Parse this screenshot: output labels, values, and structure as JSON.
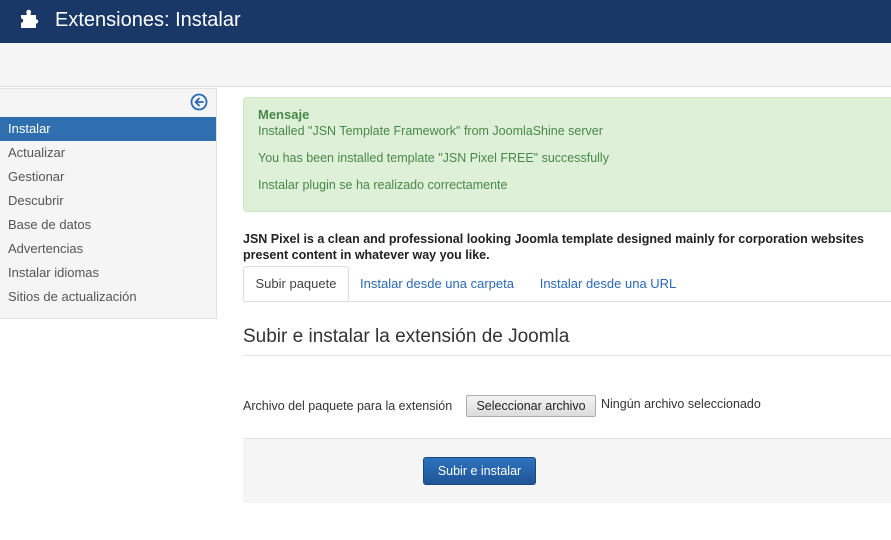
{
  "header": {
    "title": "Extensiones: Instalar",
    "icon": "puzzle-piece-icon"
  },
  "sidebar": {
    "collapse_icon": "arrow-left-circle-icon",
    "items": [
      {
        "label": "Instalar",
        "active": true
      },
      {
        "label": "Actualizar"
      },
      {
        "label": "Gestionar"
      },
      {
        "label": "Descubrir"
      },
      {
        "label": "Base de datos"
      },
      {
        "label": "Advertencias"
      },
      {
        "label": "Instalar idiomas"
      },
      {
        "label": "Sitios de actualización"
      }
    ]
  },
  "message": {
    "heading": "Mensaje",
    "lines": [
      "Installed \"JSN Template Framework\" from JoomlaShine server",
      "You has been installed template \"JSN Pixel FREE\" successfully",
      "Instalar plugin se ha realizado correctamente"
    ]
  },
  "description": {
    "line1": "JSN Pixel is a clean and professional looking Joomla template designed mainly for corporation websites",
    "line2": "present content in whatever way you like."
  },
  "tabs": [
    {
      "label": "Subir paquete",
      "active": true
    },
    {
      "label": "Instalar desde una carpeta"
    },
    {
      "label": "Instalar desde una URL"
    }
  ],
  "upload": {
    "title": "Subir e instalar la extensión de Joomla",
    "file_label": "Archivo del paquete para la extensión",
    "file_button": "Seleccionar archivo",
    "file_status": "Ningún archivo seleccionado",
    "submit_label": "Subir e instalar"
  },
  "colors": {
    "header_bg": "#1a3867",
    "active_item_bg": "#2f6fb0",
    "alert_bg": "#dff0d8",
    "alert_text": "#468847",
    "link": "#2a69b5",
    "primary_button": "#1f5597"
  }
}
